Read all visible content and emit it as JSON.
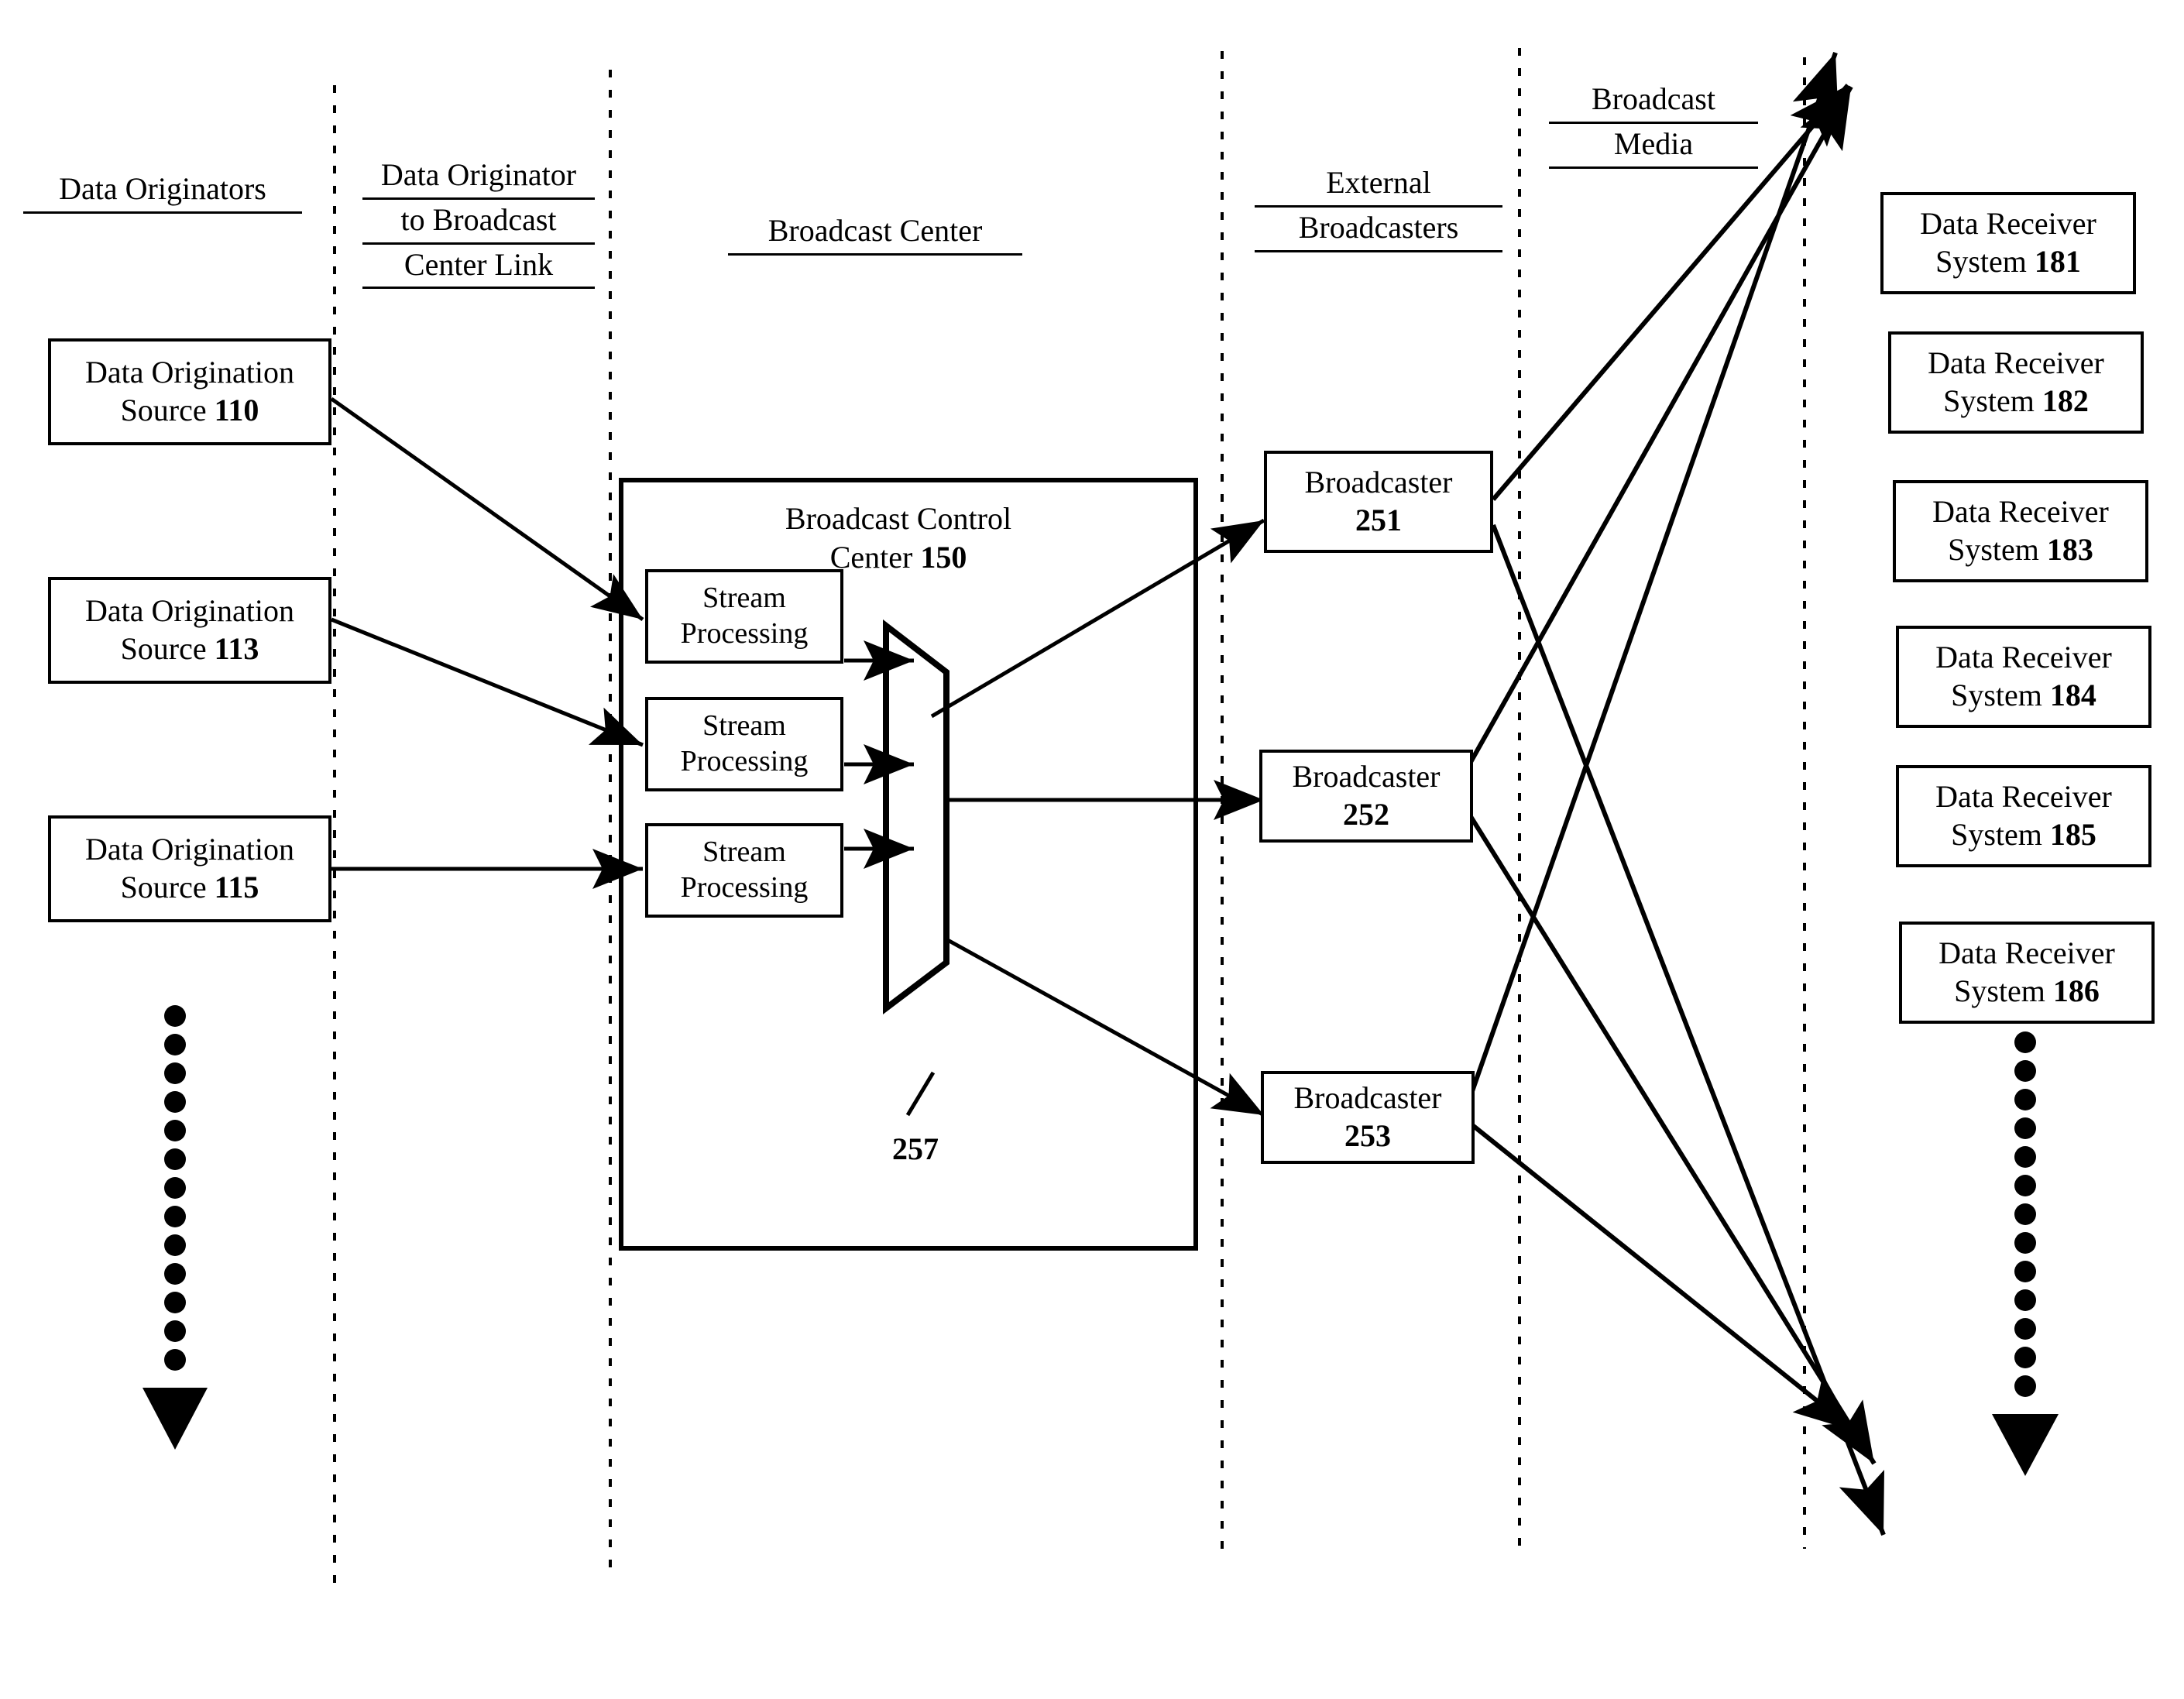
{
  "figure": {
    "title": "Broadcast data distribution block diagram",
    "stroke_color": "#000000",
    "background_color": "#ffffff"
  },
  "columns": [
    {
      "id": "data-originators",
      "label_lines": [
        "Data Originators"
      ]
    },
    {
      "id": "originator-link",
      "label_lines": [
        "Data Originator",
        "to Broadcast",
        "Center Link"
      ]
    },
    {
      "id": "broadcast-center",
      "label_lines": [
        "Broadcast Center"
      ]
    },
    {
      "id": "external-broadcasters",
      "label_lines": [
        "External",
        "Broadcasters"
      ]
    },
    {
      "id": "broadcast-media",
      "label_lines": [
        "Broadcast",
        "Media"
      ]
    }
  ],
  "sources": [
    {
      "line1": "Data Origination",
      "line2_text": "Source ",
      "line2_ref": "110"
    },
    {
      "line1": "Data Origination",
      "line2_text": "Source ",
      "line2_ref": "113"
    },
    {
      "line1": "Data Origination",
      "line2_text": "Source ",
      "line2_ref": "115"
    }
  ],
  "broadcast_control_center": {
    "title_line1": "Broadcast Control",
    "title_line2_text": "Center ",
    "title_line2_ref": "150",
    "stream_processors": [
      {
        "line1": "Stream",
        "line2": "Processing"
      },
      {
        "line1": "Stream",
        "line2": "Processing"
      },
      {
        "line1": "Stream",
        "line2": "Processing"
      }
    ],
    "multiplexer_ref": "257"
  },
  "broadcasters": [
    {
      "line1": "Broadcaster",
      "line2": "251"
    },
    {
      "line1": "Broadcaster",
      "line2": "252"
    },
    {
      "line1": "Broadcaster",
      "line2": "253"
    }
  ],
  "receivers": [
    {
      "line1": "Data Receiver",
      "line2_text": "System ",
      "line2_ref": "181"
    },
    {
      "line1": "Data Receiver",
      "line2_text": "System ",
      "line2_ref": "182"
    },
    {
      "line1": "Data Receiver",
      "line2_text": "System ",
      "line2_ref": "183"
    },
    {
      "line1": "Data Receiver",
      "line2_text": "System ",
      "line2_ref": "184"
    },
    {
      "line1": "Data Receiver",
      "line2_text": "System ",
      "line2_ref": "185"
    },
    {
      "line1": "Data Receiver",
      "line2_text": "System ",
      "line2_ref": "186"
    }
  ],
  "ellipses": [
    {
      "id": "left-ellipsis",
      "dot_count": 13
    },
    {
      "id": "right-ellipsis",
      "dot_count": 13
    }
  ]
}
